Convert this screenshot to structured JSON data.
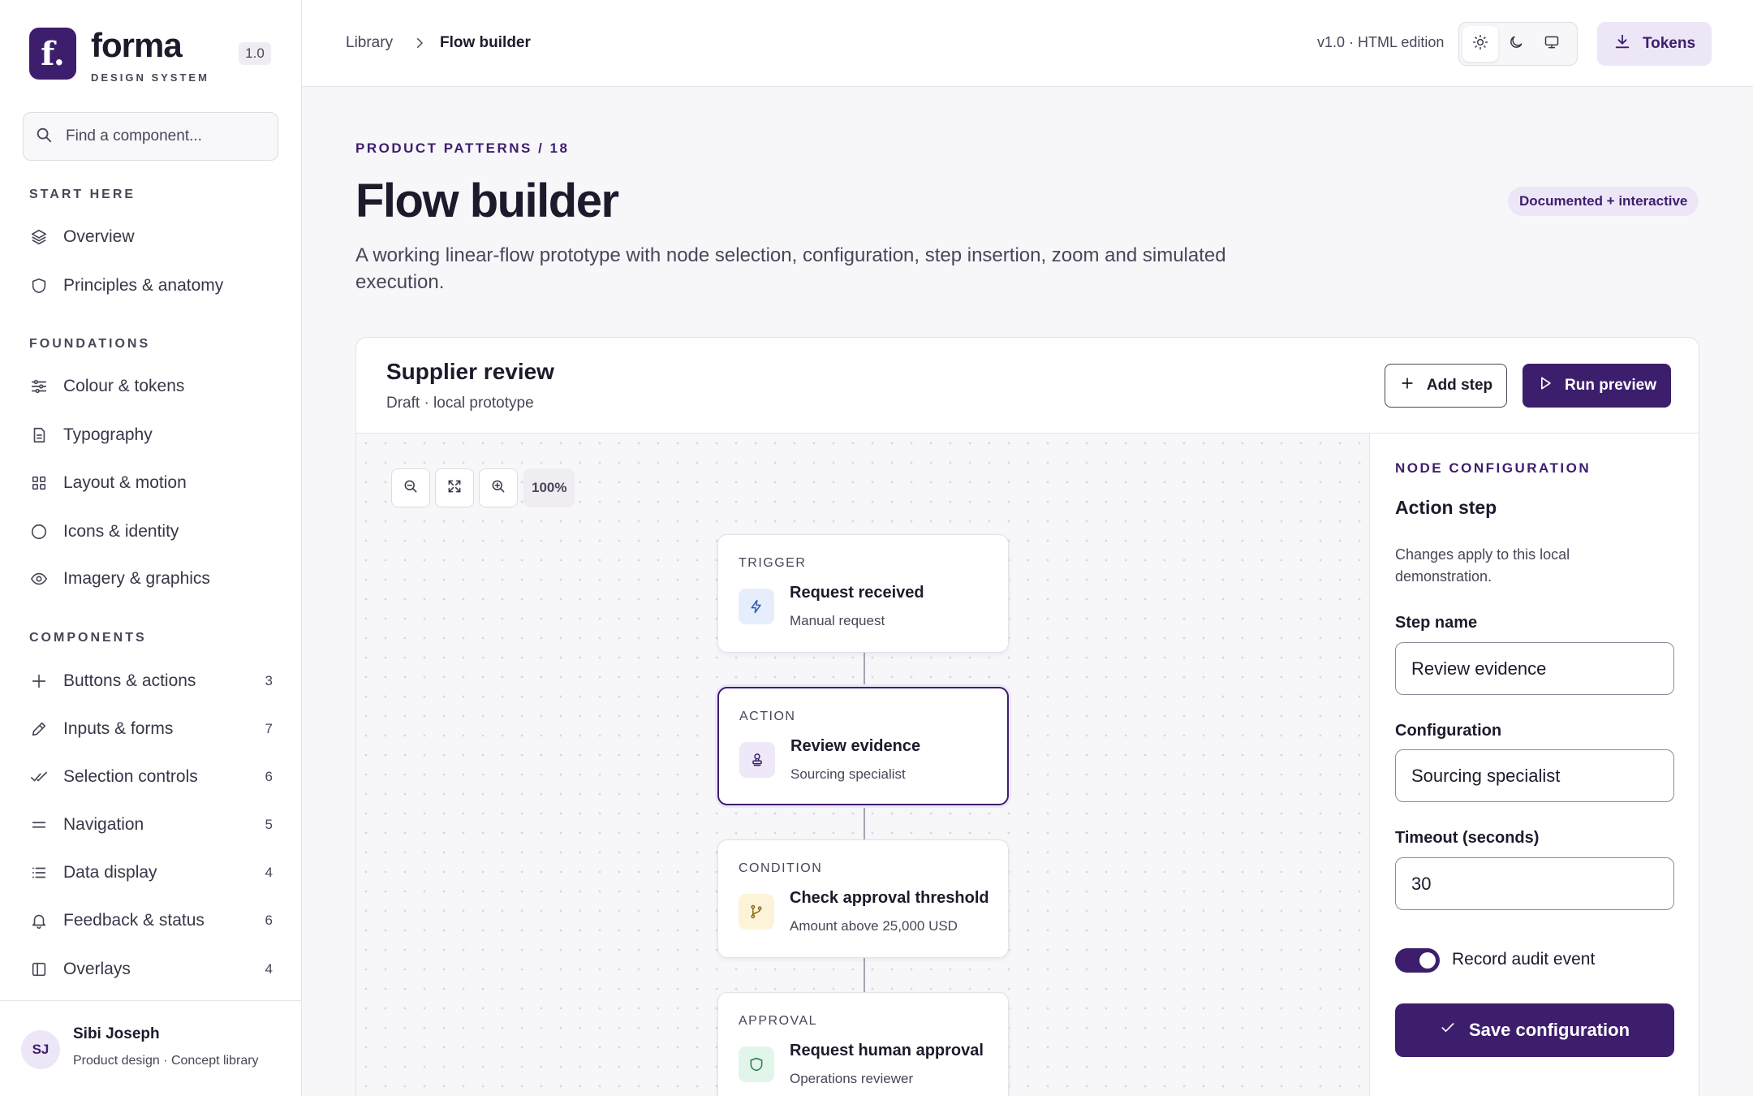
{
  "brand": {
    "logo_letter": "f.",
    "name": "forma",
    "subtitle": "DESIGN SYSTEM",
    "version": "1.0",
    "accent_color": "#3d1e6d"
  },
  "sidebar": {
    "search_placeholder": "Find a component...",
    "sections": [
      {
        "title": "START HERE",
        "items": [
          {
            "label": "Overview",
            "icon": "layers-icon"
          },
          {
            "label": "Principles & anatomy",
            "icon": "shield-icon"
          }
        ]
      },
      {
        "title": "FOUNDATIONS",
        "items": [
          {
            "label": "Colour & tokens",
            "icon": "sliders-icon"
          },
          {
            "label": "Typography",
            "icon": "document-icon"
          },
          {
            "label": "Layout & motion",
            "icon": "grid-icon"
          },
          {
            "label": "Icons & identity",
            "icon": "circle-icon"
          },
          {
            "label": "Imagery & graphics",
            "icon": "eye-icon"
          }
        ]
      },
      {
        "title": "COMPONENTS",
        "items": [
          {
            "label": "Buttons & actions",
            "count": "3",
            "icon": "plus-icon"
          },
          {
            "label": "Inputs & forms",
            "count": "7",
            "icon": "pencil-icon"
          },
          {
            "label": "Selection controls",
            "count": "6",
            "icon": "double-check-icon"
          },
          {
            "label": "Navigation",
            "count": "5",
            "icon": "menu-icon"
          },
          {
            "label": "Data display",
            "count": "4",
            "icon": "list-icon"
          },
          {
            "label": "Feedback & status",
            "count": "6",
            "icon": "bell-icon"
          },
          {
            "label": "Overlays",
            "count": "4",
            "icon": "panel-icon"
          }
        ]
      }
    ]
  },
  "user": {
    "initials": "SJ",
    "name": "Sibi Joseph",
    "role": "Product design · Concept library"
  },
  "topbar": {
    "breadcrumb": [
      "Library",
      "Flow builder"
    ],
    "edition": "v1.0 · HTML edition",
    "theme_options": [
      "sun-icon",
      "moon-icon",
      "monitor-icon"
    ],
    "active_theme": "sun-icon",
    "tokens_label": "Tokens"
  },
  "page": {
    "eyebrow": "PRODUCT PATTERNS / 18",
    "title": "Flow builder",
    "badge": "Documented + interactive",
    "lead": "A working linear-flow prototype with node selection, configuration, step insertion, zoom and simulated execution."
  },
  "flow": {
    "title": "Supplier review",
    "subtitle": "Draft · local prototype",
    "add_step_label": "Add step",
    "run_label": "Run preview",
    "zoom_level": "100%",
    "nodes": [
      {
        "kind": "TRIGGER",
        "title": "Request received",
        "sub": "Manual request",
        "icon": "bolt-icon",
        "icon_bg": "#e6eefc",
        "icon_color": "#2f5fb3"
      },
      {
        "kind": "ACTION",
        "title": "Review evidence",
        "sub": "Sourcing specialist",
        "icon": "stamp-icon",
        "icon_bg": "#eee8f8",
        "icon_color": "#3d1e6d",
        "selected": true
      },
      {
        "kind": "CONDITION",
        "title": "Check approval threshold",
        "sub": "Amount above 25,000 USD",
        "icon": "branch-icon",
        "icon_bg": "#fcf3d9",
        "icon_color": "#8a6a12"
      },
      {
        "kind": "APPROVAL",
        "title": "Request human approval",
        "sub": "Operations reviewer",
        "icon": "shield-check-icon",
        "icon_bg": "#e2f5ea",
        "icon_color": "#237a4a"
      }
    ]
  },
  "config": {
    "eyebrow": "NODE CONFIGURATION",
    "title": "Action step",
    "description": "Changes apply to this local demonstration.",
    "step_name_label": "Step name",
    "step_name_value": "Review evidence",
    "configuration_label": "Configuration",
    "configuration_value": "Sourcing specialist",
    "timeout_label": "Timeout (seconds)",
    "timeout_value": "30",
    "audit_label": "Record audit event",
    "audit_enabled": true,
    "save_label": "Save configuration"
  }
}
